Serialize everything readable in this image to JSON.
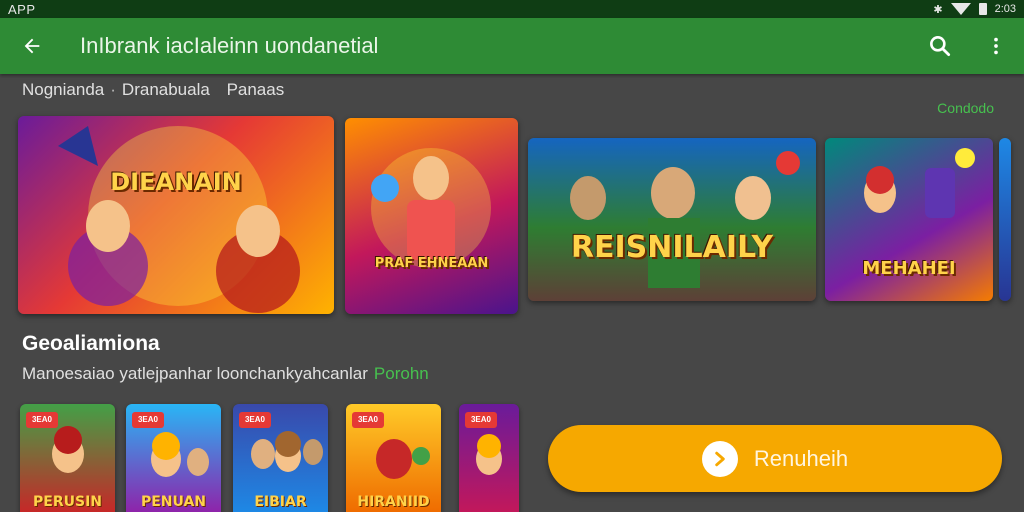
{
  "statusbar": {
    "carrier": "APP",
    "time": "2:03"
  },
  "appbar": {
    "title": "InIbrank iacIaleinn uondanetial",
    "back_icon": "arrow-back-icon",
    "search_icon": "search-icon",
    "menu_icon": "more-vert-icon"
  },
  "section1": {
    "tab1": "Nognianda",
    "tab2": "Dranabuala",
    "tab3": "Panaas",
    "see_all": "Condodo",
    "cards": [
      {
        "banner": "DIEANAIN"
      },
      {
        "banner": "PRAF EHNEAAN"
      },
      {
        "banner": "REISNILAILY"
      },
      {
        "banner": "MEHAHEI"
      }
    ]
  },
  "section2": {
    "title": "Geoaliamiona",
    "subtitle": "Manoesaiao yatlejpanhar loonchankyahcanlar",
    "link": "Porohn",
    "tiles": [
      {
        "tag": "3EA0",
        "banner": "PERUSIN"
      },
      {
        "tag": "3EA0",
        "banner": "PENUAN"
      },
      {
        "tag": "3EA0",
        "banner": "EIBIAR"
      },
      {
        "tag": "3EA0",
        "banner": "HIRANIID"
      },
      {
        "tag": "3EA0",
        "banner": ""
      }
    ]
  },
  "cta": {
    "label": "Renuheih",
    "icon": "play-icon"
  },
  "colors": {
    "appbar": "#2e8b35",
    "statusbar": "#0f3d14",
    "accent": "#47c14f",
    "cta": "#f6a800",
    "background": "#474747"
  }
}
